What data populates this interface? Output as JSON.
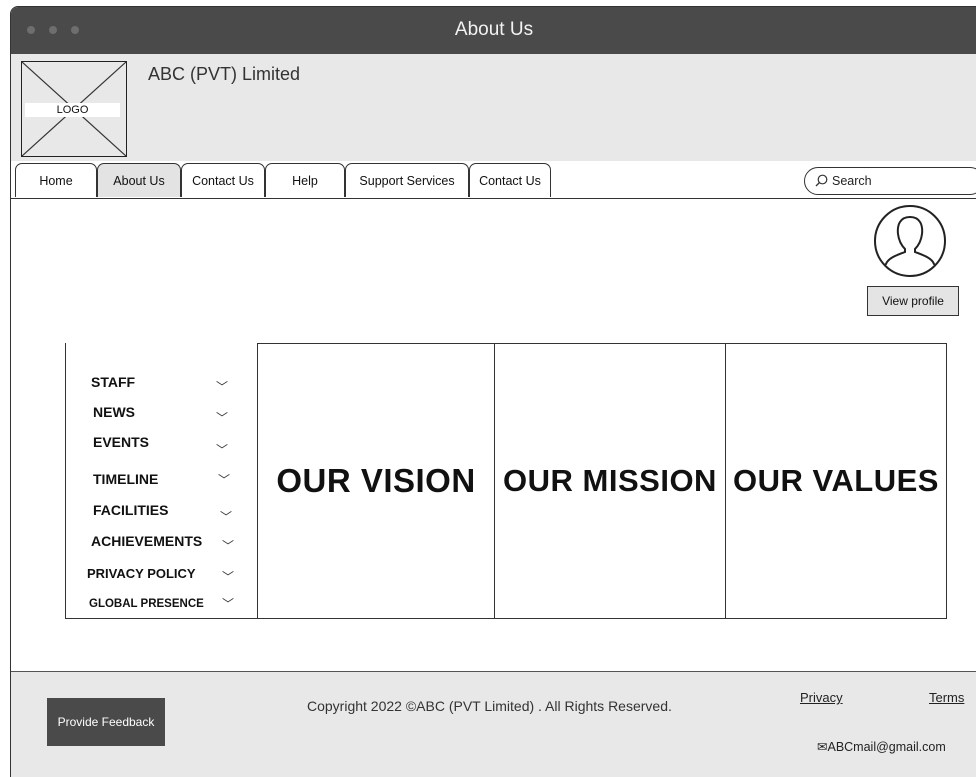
{
  "window": {
    "title": "About Us"
  },
  "header": {
    "logo_text": "LOGO",
    "company_name": "ABC (PVT) Limited"
  },
  "nav": {
    "tabs": [
      {
        "label": "Home",
        "active": false
      },
      {
        "label": "About Us",
        "active": true
      },
      {
        "label": "Contact Us",
        "active": false
      },
      {
        "label": "Help",
        "active": false
      },
      {
        "label": "Support Services",
        "active": false
      },
      {
        "label": "Contact Us",
        "active": false
      }
    ],
    "search_placeholder": "Search"
  },
  "profile": {
    "button_label": "View profile",
    "icon": "user-avatar-icon"
  },
  "side_menu": {
    "items": [
      {
        "label": "STAFF"
      },
      {
        "label": "NEWS"
      },
      {
        "label": "EVENTS"
      },
      {
        "label": "TIMELINE"
      },
      {
        "label": "FACILITIES"
      },
      {
        "label": "ACHIEVEMENTS"
      },
      {
        "label": "PRIVACY POLICY"
      },
      {
        "label": "GLOBAL PRESENCE"
      }
    ]
  },
  "panels": [
    {
      "title": "OUR VISION"
    },
    {
      "title": "OUR MISSION"
    },
    {
      "title": "OUR VALUES"
    }
  ],
  "footer": {
    "feedback_label": "Provide Feedback",
    "copyright": "Copyright 2022 ©ABC (PVT Limited) . All Rights Reserved.",
    "privacy_label": "Privacy",
    "terms_label": "Terms",
    "email": "ABCmail@gmail.com"
  },
  "colors": {
    "titlebar": "#4a4a4a",
    "header_bg": "#e8e8e8",
    "active_tab": "#e3e3e3",
    "button_dark": "#4a4a4a"
  }
}
